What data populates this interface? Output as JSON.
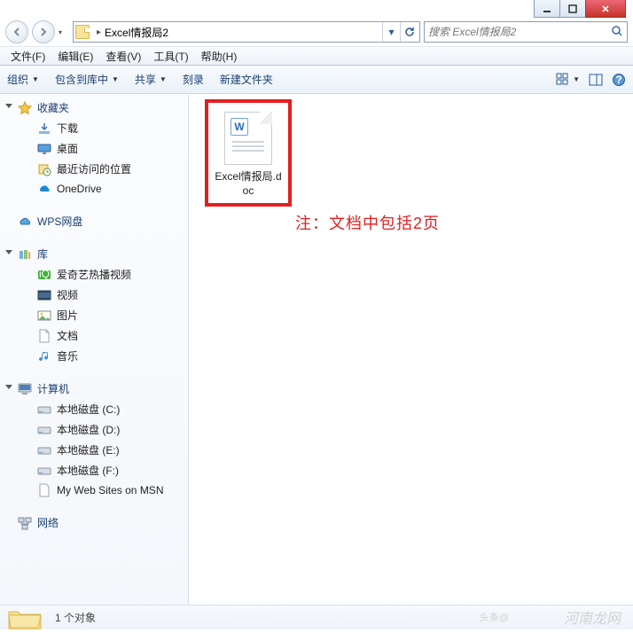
{
  "window": {
    "min": "_",
    "max": "□",
    "close": "×"
  },
  "address": {
    "folder_name": "Excel情报局2",
    "dropdown": "▾",
    "refresh": "↻"
  },
  "search": {
    "placeholder": "搜索 Excel情报局2"
  },
  "menu": {
    "file": "文件(F)",
    "edit": "编辑(E)",
    "view": "查看(V)",
    "tools": "工具(T)",
    "help": "帮助(H)"
  },
  "toolbar": {
    "organize": "组织",
    "include": "包含到库中",
    "share": "共享",
    "burn": "刻录",
    "newfolder": "新建文件夹"
  },
  "sidebar": {
    "favorites": {
      "label": "收藏夹",
      "items": [
        {
          "label": "下载"
        },
        {
          "label": "桌面"
        },
        {
          "label": "最近访问的位置"
        },
        {
          "label": "OneDrive"
        }
      ]
    },
    "wps": {
      "label": "WPS网盘"
    },
    "libraries": {
      "label": "库",
      "items": [
        {
          "label": "爱奇艺热播视频"
        },
        {
          "label": "视频"
        },
        {
          "label": "图片"
        },
        {
          "label": "文档"
        },
        {
          "label": "音乐"
        }
      ]
    },
    "computer": {
      "label": "计算机",
      "items": [
        {
          "label": "本地磁盘 (C:)"
        },
        {
          "label": "本地磁盘 (D:)"
        },
        {
          "label": "本地磁盘 (E:)"
        },
        {
          "label": "本地磁盘 (F:)"
        },
        {
          "label": "My Web Sites on MSN"
        }
      ]
    },
    "network": {
      "label": "网络"
    }
  },
  "content": {
    "file": {
      "name": "Excel情报局.doc",
      "badge": "W"
    },
    "annotation": "注：文档中包括2页"
  },
  "status": {
    "count": "1 个对象"
  },
  "watermark": {
    "main": "河南龙网",
    "side": "头条@"
  }
}
